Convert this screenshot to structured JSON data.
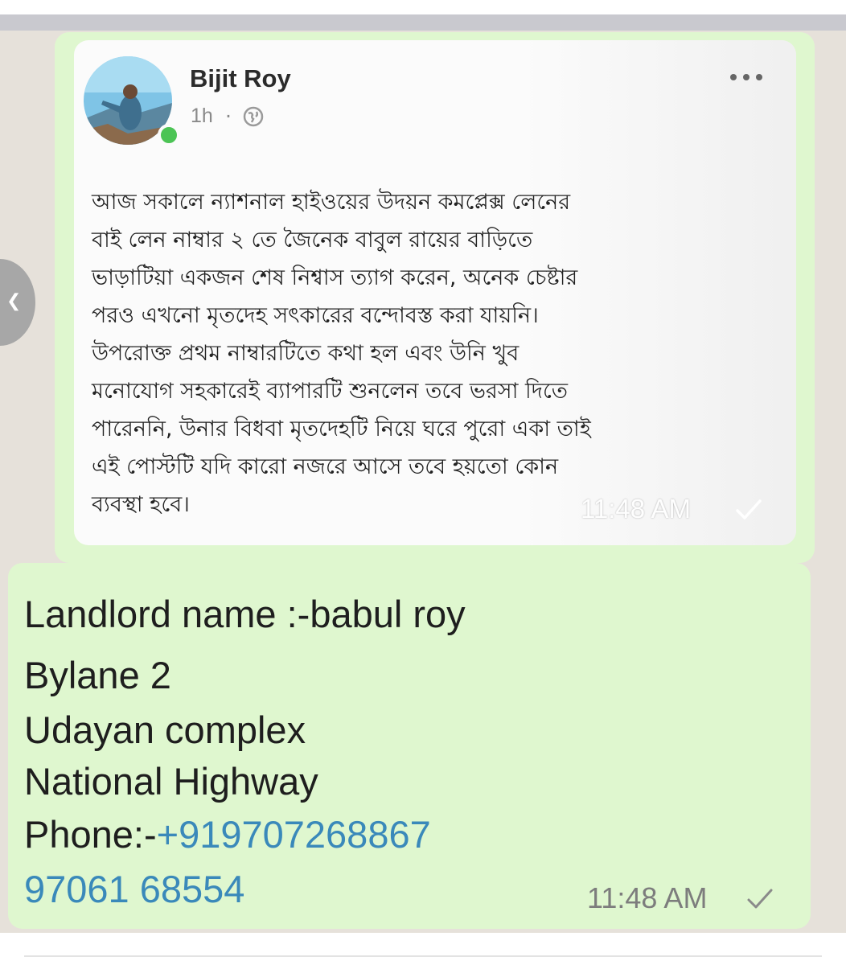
{
  "shared_post": {
    "author_name": "Bijit Roy",
    "post_age": "1h",
    "separator": "·",
    "visibility_icon": "globe-icon",
    "menu_icon": "more-options-icon",
    "text": "আজ সকালে ন্যাশনাল হাইওয়ের উদয়ন কমপ্লেক্স লেনের\nবাই লেন নাম্বার ২ তে জৈনেক বাবুল রায়ের বাড়িতে\nভাড়াটিয়া একজন শেষ নিশ্বাস ত্যাগ করেন, অনেক চেষ্টার\nপরও এখনো মৃতদেহ সৎকারের বন্দোবস্ত করা যায়নি।\nউপরোক্ত প্রথম নাম্বারটিতে কথা হল এবং উনি খুব\nমনোযোগ সহকারেই ব্যাপারটি শুনলেন তবে ভরসা দিতে\nপারেননি, উনার বিধবা মৃতদেহটি নিয়ে ঘরে পুরো একা তাই\nএই পোস্টটি যদি কারো নজরে আসে তবে হয়তো কোন\nব্যবস্থা হবে।",
    "timestamp": "11:48 AM",
    "status_icon": "single-check-icon"
  },
  "message": {
    "lines": [
      "Landlord name :-babul roy",
      "Bylane 2",
      "Udayan complex",
      "National Highway"
    ],
    "phone_label": "Phone:-",
    "phone_primary": "+919707268867",
    "phone_secondary": "97061 68554",
    "timestamp": "11:48 AM",
    "status_icon": "single-check-icon"
  },
  "colors": {
    "bubble": "#dff7cf",
    "chat_background": "#e6e1da",
    "link": "#3a89ba",
    "online": "#4cc455"
  }
}
